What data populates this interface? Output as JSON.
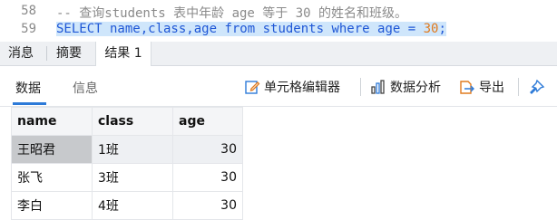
{
  "editor": {
    "lines": [
      {
        "number": "58",
        "text": "-- 查询students 表中年龄 age 等于 30 的姓名和班级。"
      },
      {
        "number": "59",
        "select": "SELECT",
        "fields": " name,class,age ",
        "from": "from",
        "table": " students ",
        "where": "where",
        "cond": " age = ",
        "value": "30",
        "end": ";"
      }
    ]
  },
  "tabs": [
    "消息",
    "摘要",
    "结果 1"
  ],
  "subtabs": [
    "数据",
    "信息"
  ],
  "toolbar": {
    "cell_editor": "单元格编辑器",
    "data_analysis": "数据分析",
    "export": "导出"
  },
  "table": {
    "headers": [
      "name",
      "class",
      "age"
    ],
    "rows": [
      [
        "王昭君",
        "1班",
        "30"
      ],
      [
        "张飞",
        "3班",
        "30"
      ],
      [
        "李白",
        "4班",
        "30"
      ]
    ]
  }
}
